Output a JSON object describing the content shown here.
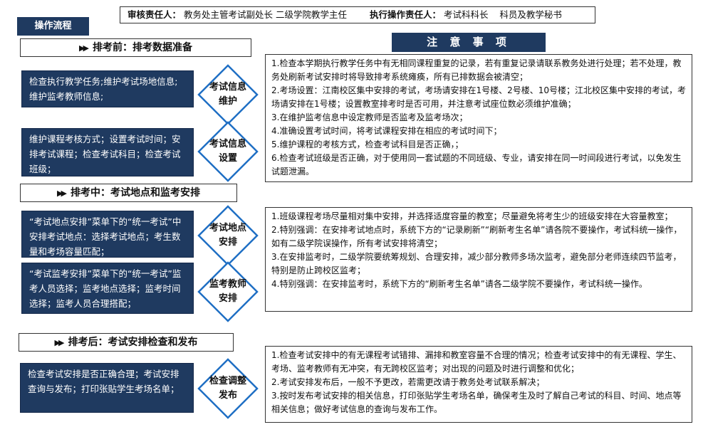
{
  "header": {
    "reviewer_label": "审核责任人：",
    "reviewer_value": "教务处主管考试副处长 二级学院教学主任",
    "executor_label": "执行操作责任人：",
    "executor_value": "考试科科长    科员及教学秘书"
  },
  "flow_tag": "操作流程",
  "notice_title": "注 意 事 项",
  "phases": [
    {
      "title": "排考前：排考数据准备",
      "steps": [
        {
          "box": "检查执行教学任务;维护考试场地信息;维护监考教师信息;",
          "diamond": "考试信息维护"
        },
        {
          "box": "维护课程考核方式；设置考试时间；安排考试课程；检查考试科目；检查考试班级；",
          "diamond": "考试信息设置"
        }
      ],
      "notes": [
        "1.检查本学期执行教学任务中有无相同课程重复的记录，若有重复记录请联系教务处进行处理；若不处理，教务处刷新考试安排时将导致排考系统瘫痪，所有已排数据会被清空；",
        "2.考场设置：江南校区集中安排的考试，考场请安排在1号楼、2号楼、10号楼；江北校区集中安排的考试，考场请安排在1号楼；设置教室排考时是否可用，并注意考试座位数必须维护准确；",
        "3.在维护监考信息中设定教师是否监考及监考场次；",
        "4.准确设置考试时间，将考试课程安排在相应的考试时间下；",
        "5.维护课程的考核方式，检查考试科目是否正确，；",
        "6.检查考试班级是否正确，对于使用同一套试题的不同班级、专业，请安排在同一时间段进行考试，以免发生试题泄漏。"
      ]
    },
    {
      "title": "排考中：考试地点和监考安排",
      "steps": [
        {
          "box": "“考试地点安排”菜单下的“统一考试”中安排考试地点：选择考试地点；考生数量和考场容量匹配；",
          "diamond": "考试地点安排"
        },
        {
          "box": "“考试监考安排”菜单下的“统一考试”监考人员选择；监考地点选择；监考时间选择；监考人员合理搭配；",
          "diamond": "监考教师安排"
        }
      ],
      "notes": [
        "1.班级课程考场尽量相对集中安排，并选择适度容量的教室；尽量避免将考生少的班级安排在大容量教室；",
        "2.特别强调：在安排考试地点时，系统下方的“记录刷新”“刷新考生名单”请各院不要操作，考试科统一操作，如有二级学院误操作，所有考试安排将清空；",
        "3.在安排监考时，二级学院要统筹规划、合理安排，减少部分教师多场次监考，避免部分老师连续四节监考，特别是防止跨校区监考；",
        "4.特别强调：在安排监考时，系统下方的“刷新考生名单”请各二级学院不要操作，考试科统一操作。"
      ]
    },
    {
      "title": "排考后：考试安排检查和发布",
      "steps": [
        {
          "box": "检查考试安排是否正确合理；考试安排查询与发布；打印张贴学生考场名单；",
          "diamond": "检查调整发布"
        }
      ],
      "notes": [
        "1.检查考试安排中的有无课程考试错排、漏排和教室容量不合理的情况；检查考试安排中的有无课程、学生、考场、监考教师有无冲突，有无跨校区监考；对出现的问题及时进行调整和优化；",
        "2.考试安排发布后，一般不予更改，若需更改请于教务处考试联系解决；",
        "3.按时发布考试安排的相关信息，打印张贴学生考场名单，确保考生及时了解自己考试的科目、时间、地点等相关信息；做好考试信息的查询与发布工作。"
      ]
    }
  ],
  "colors": {
    "navy": "#1f3a60",
    "diamond_border": "#1f6fc4"
  }
}
